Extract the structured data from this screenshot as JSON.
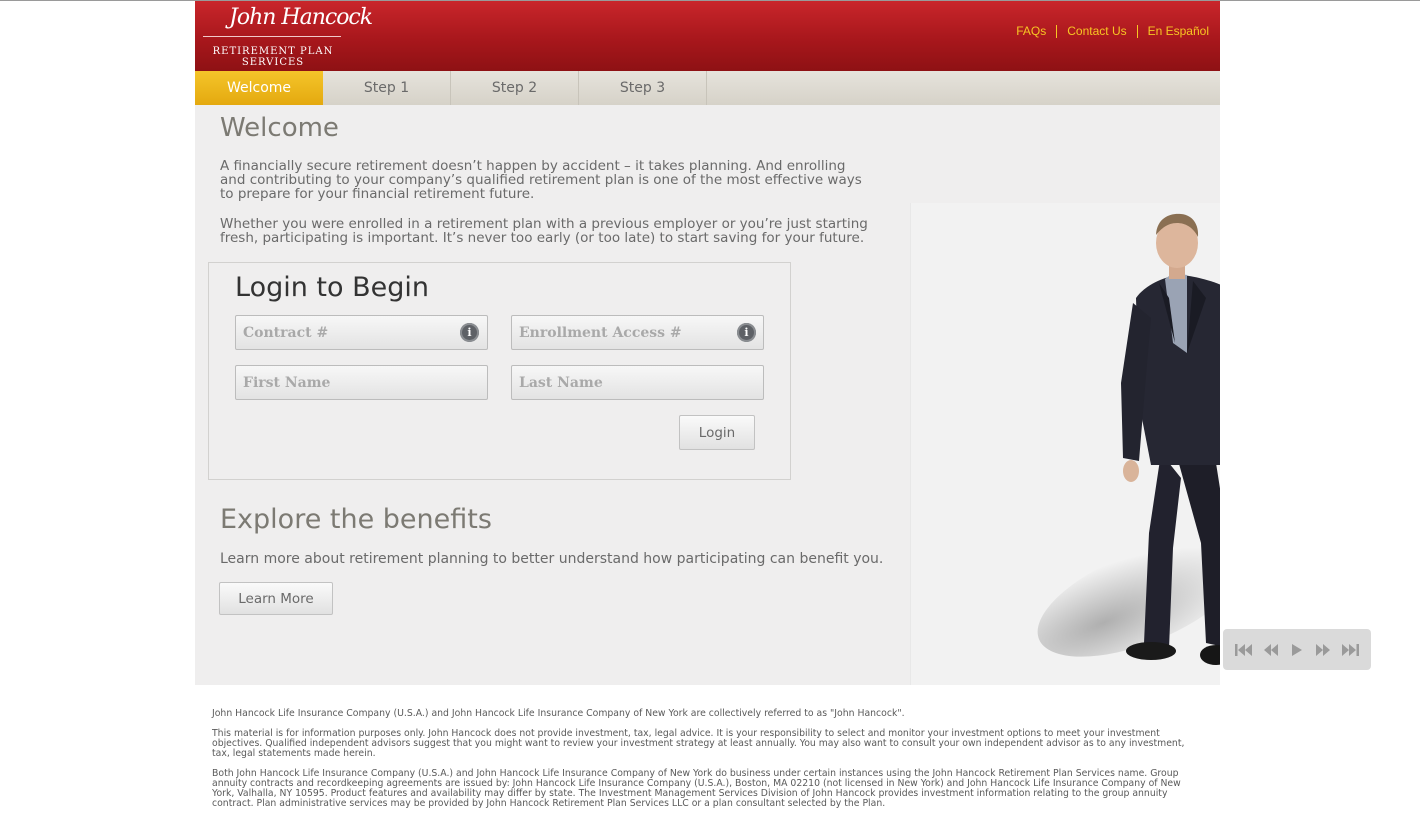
{
  "header": {
    "logo": {
      "script": "John Hancock",
      "sub_line1": "RETIREMENT PLAN",
      "sub_line2": "SERVICES"
    },
    "links": [
      {
        "label": "FAQs"
      },
      {
        "label": "Contact Us"
      },
      {
        "label": "En Español"
      }
    ],
    "link_color": "#f7c623",
    "brand_color": "#a8171c"
  },
  "tabs": [
    {
      "label": "Welcome",
      "active": true
    },
    {
      "label": "Step 1",
      "active": false
    },
    {
      "label": "Step 2",
      "active": false
    },
    {
      "label": "Step 3",
      "active": false
    }
  ],
  "main": {
    "title": "Welcome",
    "para1": "A financially secure retirement doesn’t happen by accident – it takes planning. And enrolling and contributing to your company’s qualified retirement plan is one of the most effective ways to prepare for your financial retirement future.",
    "para2": "Whether you were enrolled in a retirement plan with a previous employer or you’re just starting fresh, participating is important. It’s never too early (or too late) to start saving for your future."
  },
  "login": {
    "title": "Login to Begin",
    "contract_placeholder": "Contract #",
    "enrollment_placeholder": "Enrollment Access #",
    "first_name_placeholder": "First Name",
    "last_name_placeholder": "Last Name",
    "info_glyph": "i",
    "button_label": "Login"
  },
  "explore": {
    "title": "Explore the benefits",
    "text": "Learn more about retirement planning to better understand how participating can benefit you.",
    "button_label": "Learn More"
  },
  "video": {
    "controls": [
      "skip-back-icon",
      "rewind-icon",
      "play-icon",
      "fast-forward-icon",
      "skip-forward-icon"
    ]
  },
  "footer": {
    "p1": "John Hancock Life Insurance Company (U.S.A.) and John Hancock Life Insurance Company of New York are collectively referred to as \"John Hancock\".",
    "p2": "This material is for information purposes only. John Hancock does not provide investment, tax, legal advice. It is your responsibility to select and monitor your investment options to meet your investment objectives. Qualified independent advisors suggest that you might want to review your investment strategy at least annually. You may also want to consult your own independent advisor as to any investment, tax, legal statements made herein.",
    "p3": "Both John Hancock Life Insurance Company (U.S.A.) and John Hancock Life Insurance Company of New York do business under certain instances using the John Hancock Retirement Plan Services name. Group annuity contracts and recordkeeping agreements are issued by: John Hancock Life Insurance Company (U.S.A.), Boston, MA 02210 (not licensed in New York) and John Hancock Life Insurance Company of New York, Valhalla, NY 10595. Product features and availability may differ by state. The Investment Management Services Division of John Hancock provides investment information relating to the group annuity contract. Plan administrative services may be provided by John Hancock Retirement Plan Services LLC or a plan consultant selected by the Plan."
  }
}
